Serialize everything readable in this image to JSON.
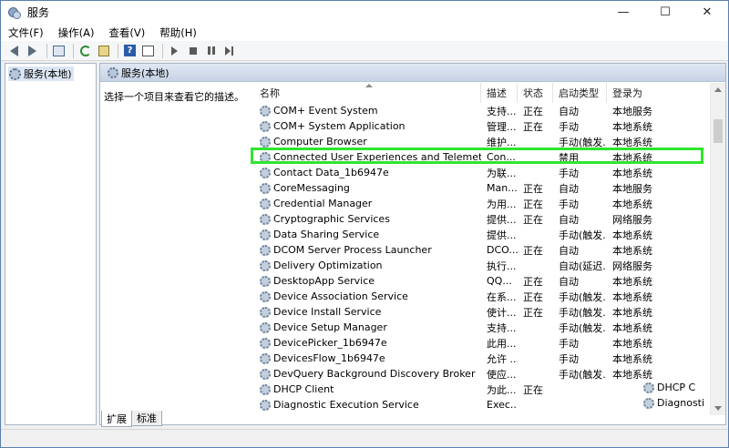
{
  "window": {
    "title": "服务",
    "controls": {
      "minimize": "—",
      "maximize": "☐",
      "close": "✕"
    }
  },
  "menu": [
    "文件(F)",
    "操作(A)",
    "查看(V)",
    "帮助(H)"
  ],
  "toolbar": {
    "icons": [
      "back-icon",
      "forward-icon",
      "show-hide-tree-icon",
      "refresh-icon",
      "export-list-icon",
      "help-icon",
      "properties-icon",
      "start-service-icon",
      "stop-service-icon",
      "pause-service-icon",
      "restart-service-icon"
    ]
  },
  "tree": {
    "selected": "服务(本地)"
  },
  "pane": {
    "header": "服务(本地)",
    "description_hint": "选择一个项目来查看它的描述。"
  },
  "list": {
    "columns": [
      "名称",
      "描述",
      "状态",
      "启动类型",
      "登录为"
    ],
    "rows": [
      {
        "name": "COM+ Event System",
        "desc": "支持...",
        "status": "正在",
        "start": "自动",
        "logon": "本地服务"
      },
      {
        "name": "COM+ System Application",
        "desc": "管理...",
        "status": "正在",
        "start": "手动",
        "logon": "本地系统"
      },
      {
        "name": "Computer Browser",
        "desc": "维护...",
        "status": "",
        "start": "手动(触发...",
        "logon": "本地系统"
      },
      {
        "name": "Connected User Experiences and Telemetry",
        "desc": "Con...",
        "status": "",
        "start": "禁用",
        "logon": "本地系统"
      },
      {
        "name": "Contact Data_1b6947e",
        "desc": "为联...",
        "status": "",
        "start": "手动",
        "logon": "本地系统"
      },
      {
        "name": "CoreMessaging",
        "desc": "Man...",
        "status": "正在",
        "start": "自动",
        "logon": "本地服务"
      },
      {
        "name": "Credential Manager",
        "desc": "为用...",
        "status": "正在",
        "start": "手动",
        "logon": "本地系统"
      },
      {
        "name": "Cryptographic Services",
        "desc": "提供...",
        "status": "正在",
        "start": "自动",
        "logon": "网络服务"
      },
      {
        "name": "Data Sharing Service",
        "desc": "提供...",
        "status": "",
        "start": "手动(触发...",
        "logon": "本地系统"
      },
      {
        "name": "DCOM Server Process Launcher",
        "desc": "DCO...",
        "status": "正在",
        "start": "自动",
        "logon": "本地系统"
      },
      {
        "name": "Delivery Optimization",
        "desc": "执行...",
        "status": "",
        "start": "自动(延迟...",
        "logon": "网络服务"
      },
      {
        "name": "DesktopApp Service",
        "desc": "QQ...",
        "status": "正在",
        "start": "自动",
        "logon": "本地系统"
      },
      {
        "name": "Device Association Service",
        "desc": "在系...",
        "status": "正在",
        "start": "手动(触发...",
        "logon": "本地系统"
      },
      {
        "name": "Device Install Service",
        "desc": "使计...",
        "status": "正在",
        "start": "手动(触发...",
        "logon": "本地系统"
      },
      {
        "name": "Device Setup Manager",
        "desc": "支持...",
        "status": "",
        "start": "手动(触发...",
        "logon": "本地系统"
      },
      {
        "name": "DevicePicker_1b6947e",
        "desc": "此用...",
        "status": "",
        "start": "手动",
        "logon": "本地系统"
      },
      {
        "name": "DevicesFlow_1b6947e",
        "desc": "允许 ...",
        "status": "",
        "start": "手动",
        "logon": "本地系统"
      },
      {
        "name": "DevQuery Background Discovery Broker",
        "desc": "使应...",
        "status": "",
        "start": "手动(触发...",
        "logon": "本地系统"
      },
      {
        "name": "DHCP Client",
        "desc": "为此...",
        "status": "正在",
        "start": "",
        "logon": ""
      },
      {
        "name": "Diagnostic Execution Service",
        "desc": "Exec...",
        "status": "",
        "start": "",
        "logon": ""
      }
    ],
    "overflow_items": [
      "DHCP C",
      "Diagnosti"
    ]
  },
  "tabs": [
    "扩展",
    "标准"
  ],
  "colors": {
    "highlight": "#2ee62e",
    "header_bg": "#c7d4e6"
  }
}
